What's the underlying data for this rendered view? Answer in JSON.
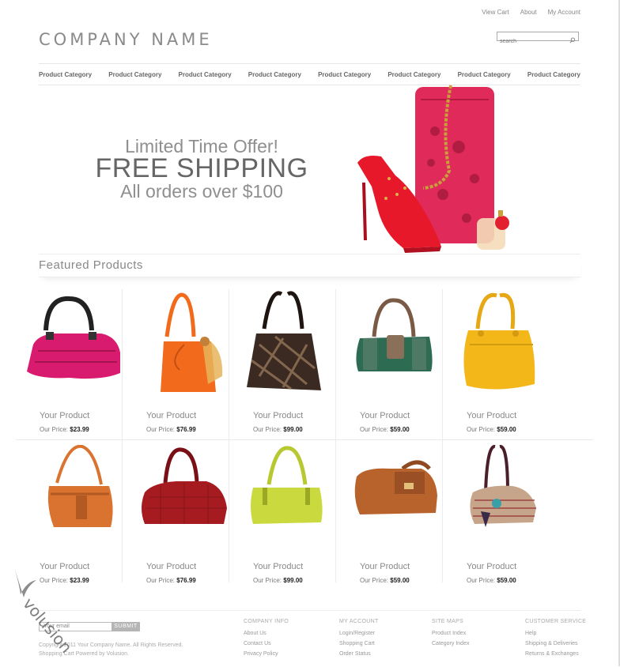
{
  "top_links": [
    "View Cart",
    "About",
    "My Account"
  ],
  "logo": "COMPANY NAME",
  "search": {
    "placeholder": "search"
  },
  "nav": [
    "Product Category",
    "Product Category",
    "Product Category",
    "Product Category",
    "Product Category",
    "Product Category",
    "Product Category",
    "Product Category"
  ],
  "banner": {
    "line1": "Limited Time Offer!",
    "line2": "FREE SHIPPING",
    "line3": "All orders over $100"
  },
  "featured_title": "Featured Products",
  "products": [
    {
      "name": "Your Product",
      "price_label": "Our Price:",
      "price": "$23.99",
      "color": "#d81b6e",
      "icon": "pink-handbag"
    },
    {
      "name": "Your Product",
      "price_label": "Our Price:",
      "price": "$76.99",
      "color": "#f26a1b",
      "icon": "orange-handbag"
    },
    {
      "name": "Your Product",
      "price_label": "Our Price:",
      "price": "$99.00",
      "color": "#3b2a22",
      "icon": "brown-pattern-handbag"
    },
    {
      "name": "Your Product",
      "price_label": "Our Price:",
      "price": "$59.00",
      "color": "#2e6b53",
      "icon": "green-handbag"
    },
    {
      "name": "Your Product",
      "price_label": "Our Price:",
      "price": "$59.00",
      "color": "#f3b71a",
      "icon": "yellow-handbag"
    },
    {
      "name": "Your Product",
      "price_label": "Our Price:",
      "price": "$23.99",
      "color": "#d9732f",
      "icon": "tan-handbag"
    },
    {
      "name": "Your Product",
      "price_label": "Our Price:",
      "price": "$76.99",
      "color": "#a51b1f",
      "icon": "red-croc-handbag"
    },
    {
      "name": "Your Product",
      "price_label": "Our Price:",
      "price": "$99.00",
      "color": "#c9d93e",
      "icon": "lime-handbag"
    },
    {
      "name": "Your Product",
      "price_label": "Our Price:",
      "price": "$59.00",
      "color": "#b8622c",
      "icon": "brown-leather-handbag"
    },
    {
      "name": "Your Product",
      "price_label": "Our Price:",
      "price": "$59.00",
      "color": "#c6a58a",
      "icon": "woven-handbag"
    }
  ],
  "footer": {
    "email_placeholder": "Your email",
    "submit": "SUBMIT",
    "copyright_1": "Copyright 2011 Your Company Name. All Rights Reserved.",
    "copyright_2": "Shopping Cart Powered by Volusion.",
    "columns": [
      {
        "heading": "COMPANY INFO",
        "links": [
          "About Us",
          "Contact Us",
          "Privacy Policy"
        ]
      },
      {
        "heading": "MY ACCOUNT",
        "links": [
          "Login/Register",
          "Shopping Cart",
          "Order Status"
        ]
      },
      {
        "heading": "SITE MAPS",
        "links": [
          "Product Index",
          "Category Index"
        ]
      },
      {
        "heading": "CUSTOMER SERVICE",
        "links": [
          "Help",
          "Shipping & Deliveries",
          "Returns & Exchanges"
        ]
      }
    ]
  },
  "watermark": "volusion"
}
